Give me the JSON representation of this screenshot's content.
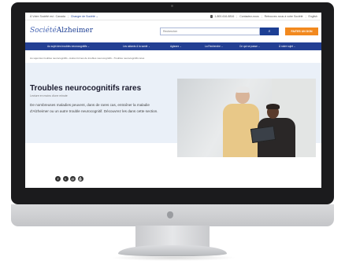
{
  "topbar": {
    "location": "À Votre Société est : Canada",
    "change_society": "Changer de Société ⌄",
    "phone": "1-800-616-8816",
    "contact": "Contactez-nous",
    "find_society": "Retrouvez-nous à votre Société",
    "language": "English"
  },
  "brand": {
    "logo_italic": "Société",
    "logo_main": "Alzheimer"
  },
  "search": {
    "placeholder": "Rechercher",
    "button_icon": "search-icon"
  },
  "donate": {
    "label": "FAITES UN DON"
  },
  "nav": {
    "items": [
      "Au sujet des troubles neurocognitifs ⌄",
      "Les aidants & la santé ⌄",
      "Agissez ⌄",
      "La Recherche ⌄",
      "Ce qui se passe ⌄",
      "À notre sujet ⌄"
    ]
  },
  "breadcrumb": "Au sujet des troubles neurocognitifs  ›  Autres formes de troubles neurocognitifs  ›  Troubles neurocognitifs rares",
  "hero": {
    "title": "Troubles neurocognitifs rares",
    "subtitle": "Lecture en moins d'une minute",
    "body": "De nombreuses maladies peuvent, dans de rares cas, entraîner la maladie d'Alzheimer ou un autre trouble neurocognitif. Découvrez les dans cette section."
  },
  "social": {
    "icons": [
      "facebook-icon",
      "twitter-icon",
      "email-icon",
      "print-icon"
    ],
    "glyphs": [
      "f",
      "t",
      "@",
      "⎙"
    ]
  },
  "colors": {
    "brand_blue": "#1d3f94",
    "nav_blue": "#233f93",
    "donate_orange": "#f2891e",
    "hero_bg": "#eaf0f8"
  }
}
